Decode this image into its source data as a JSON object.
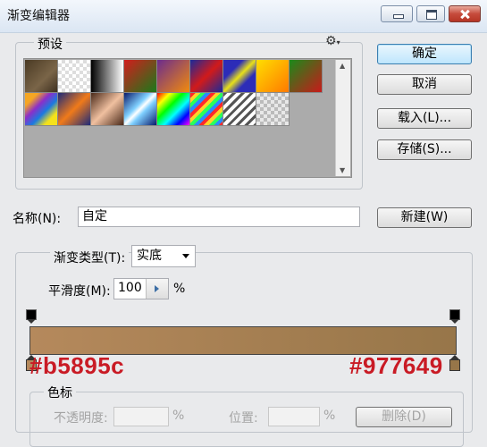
{
  "window": {
    "title": "渐变编辑器"
  },
  "presets": {
    "label": "预设",
    "icon": "gear-icon",
    "swatches": [
      "linear-gradient(135deg,#4a3a24,#7a6548 60%,#3e3020)",
      "repeating-conic-gradient(#ddd 0% 25%, #fff 0% 50%) 0 0/8px 8px",
      "linear-gradient(90deg,#000,#fff)",
      "linear-gradient(135deg,#d21d1d,#1a7a1a)",
      "linear-gradient(135deg,#6b2c8e,#f28b0c)",
      "linear-gradient(135deg,#1a2a9a,#d11a1a 50%,#1a2a9a)",
      "linear-gradient(135deg,#2c2cb8 30%,#e8e01a 50%,#2c2cb8 70%)",
      "linear-gradient(135deg,#ffde00,#ff7a00)",
      "linear-gradient(135deg,#1a8a1a,#c81a1a)",
      "linear-gradient(135deg,#f5a623 20%,#8b2fc9 40%,#1a7ae0 60%,#f5e11a 80%)",
      "linear-gradient(135deg,#1c2a7a,#f07a1a 50%,#1c2a7a)",
      "linear-gradient(135deg,#4a2a1a,#f0c0a0 50%,#4a2a1a)",
      "linear-gradient(135deg,#0a1a6a,#7fd0ff 40%,#ffffff 50%,#7fd0ff 60%,#0a1a6a)",
      "linear-gradient(135deg,#ff0000,#ffff00,#00ff00,#00ffff,#0000ff,#ff00ff)",
      "repeating-linear-gradient(135deg,#ff2a2a 0 4px,#ffd42a 4px 8px,#2aff5a 8px 12px,#2a8aff 12px 16px)",
      "repeating-linear-gradient(135deg,#555 0 3px,#fff 3px 7px)",
      "repeating-conic-gradient(#bbb 0% 25%, #e8e8e8 0% 50%) 0 0/8px 8px"
    ]
  },
  "buttons": {
    "ok": "确定",
    "cancel": "取消",
    "load": "载入(L)...",
    "save": "存储(S)...",
    "new": "新建(W)"
  },
  "name_field": {
    "label": "名称(N):",
    "value": "自定"
  },
  "gradient": {
    "type_label": "渐变类型(T):",
    "type_value": "实底",
    "smoothness_label": "平滑度(M):",
    "smoothness_value": "100",
    "smoothness_unit": "%",
    "left_color": "#b5895c",
    "right_color": "#977649",
    "left_annotation": "#b5895c",
    "right_annotation": "#977649"
  },
  "stops_group": {
    "label": "色标",
    "opacity_label": "不透明度:",
    "opacity_unit": "%",
    "location_label": "位置:",
    "location_unit": "%",
    "delete_label": "删除(D)"
  }
}
